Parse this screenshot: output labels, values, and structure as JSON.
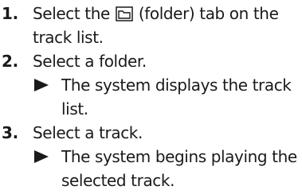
{
  "steps": [
    {
      "number": "1.",
      "lines": [
        "Select the",
        "(folder) tab on the",
        "track list."
      ]
    },
    {
      "number": "2.",
      "lines": [
        "Select a folder."
      ],
      "result": [
        "The system displays the track",
        "list."
      ]
    },
    {
      "number": "3.",
      "lines": [
        "Select a track."
      ],
      "result": [
        "The system begins playing the",
        "selected track."
      ]
    }
  ],
  "icons": {
    "folder_tab": "folder-icon",
    "result_marker": "triangle-right-icon"
  }
}
